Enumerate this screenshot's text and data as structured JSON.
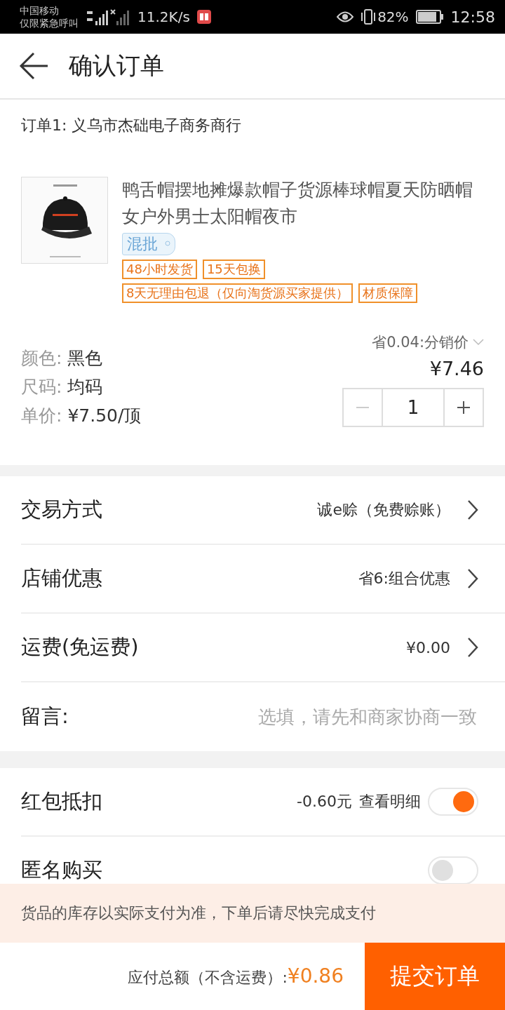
{
  "status_bar": {
    "carrier": "中国移动",
    "carrier_note": "仅限紧急呼叫",
    "speed": "11.2K/s",
    "battery": "82%",
    "time": "12:58"
  },
  "header": {
    "title": "确认订单"
  },
  "order": {
    "shop": "订单1: 义乌市杰础电子商务商行",
    "product": {
      "kind": "picture",
      "title": "鸭舌帽摆地摊爆款帽子货源棒球帽夏天防晒帽女户外男士太阳帽夜市",
      "badge": "混批",
      "tags": [
        [
          "48小时发货",
          "15天包换"
        ],
        [
          "8天无理由包退（仅向淘货源买家提供）",
          "材质保障"
        ]
      ]
    },
    "attributes": [
      {
        "label": "颜色:",
        "value": "黑色"
      },
      {
        "label": "尺码:",
        "value": "均码"
      },
      {
        "label": "单价:",
        "value": "¥7.50/顶"
      }
    ],
    "discount": "省0.04:分销价",
    "price": "¥7.46",
    "quantity": "1",
    "minus_disabled": true
  },
  "settings": [
    {
      "label": "交易方式",
      "value": "诚e赊（免费赊账）"
    },
    {
      "label": "店铺优惠",
      "value": "省6:组合优惠"
    },
    {
      "label": "运费(免运费)",
      "value": "¥0.00"
    }
  ],
  "message": {
    "label": "留言:",
    "placeholder": "选填，请先和商家协商一致"
  },
  "options": [
    {
      "label": "红包抵扣",
      "value": "-0.60元",
      "link": "查看明细",
      "on": true
    },
    {
      "label": "匿名购买",
      "on": false
    }
  ],
  "notice": "货品的库存以实际支付为准，下单后请尽快完成支付",
  "footer": {
    "total_label": "应付总额（不含运费）:",
    "total": "¥0.86",
    "submit": "提交订单"
  }
}
